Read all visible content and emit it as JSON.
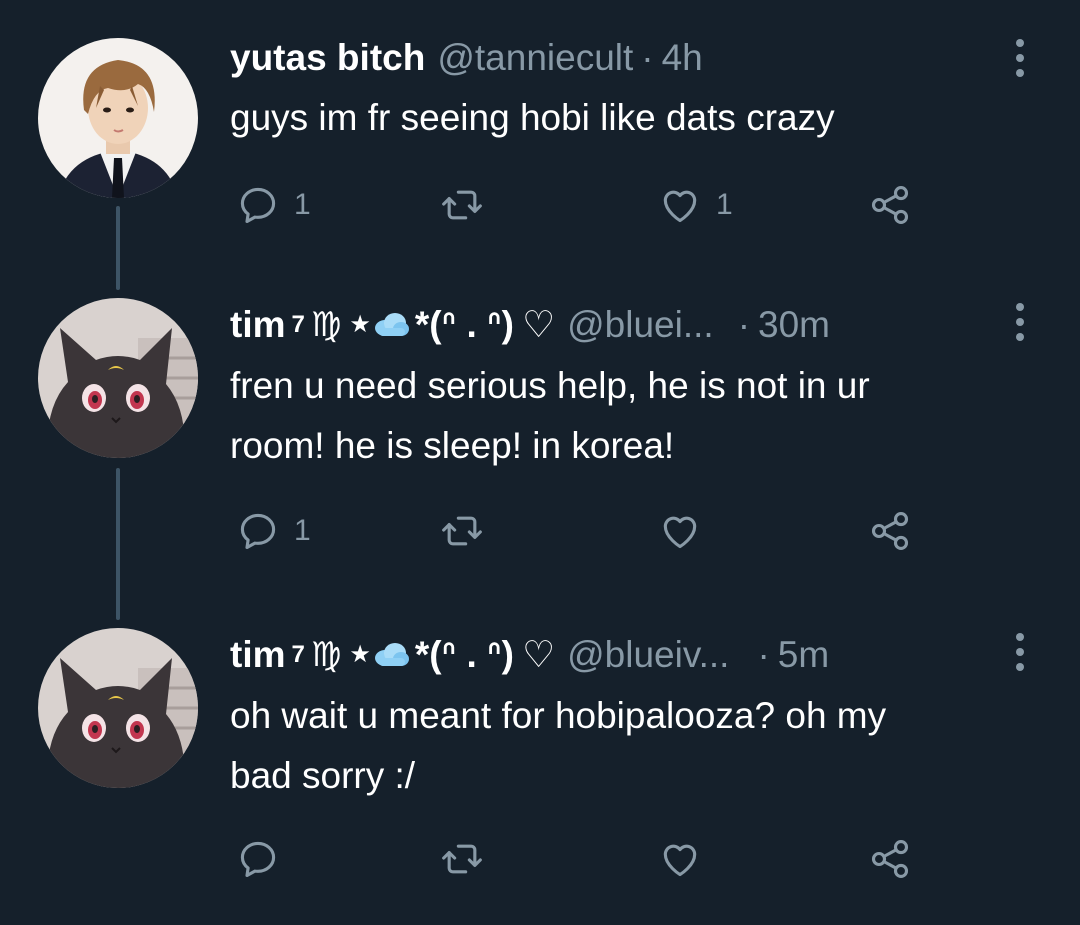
{
  "tweets": [
    {
      "name": "yutas bitch",
      "handle": "@tanniecult",
      "separator": "·",
      "time": "4h",
      "text": "guys im fr seeing hobi like dats crazy",
      "replies": "1",
      "retweets": "",
      "likes": "1",
      "avatar_icon": "person-portrait-avatar"
    },
    {
      "name": "tim",
      "name_sup": "7",
      "name_virgo": "♍",
      "name_star": "★",
      "name_kaomoji": "*(ᐢ . ᐢ)",
      "name_heart": "♡",
      "handle": "@bluei...",
      "separator": "·",
      "time": "30m",
      "text": "fren u need serious help, he is not in ur\nroom! he is sleep! in korea!",
      "replies": "1",
      "retweets": "",
      "likes": "",
      "avatar_icon": "black-cat-avatar"
    },
    {
      "name": "tim",
      "name_sup": "7",
      "name_virgo": "♍",
      "name_star": "★",
      "name_kaomoji": "*(ᐢ . ᐢ)",
      "name_heart": "♡",
      "handle": "@blueiv...",
      "separator": "·",
      "time": "5m",
      "text": "oh wait u meant for hobipalooza? oh my\nbad sorry :/",
      "replies": "",
      "retweets": "",
      "likes": "",
      "avatar_icon": "black-cat-avatar"
    }
  ],
  "colors": {
    "background": "#15202b",
    "text_primary": "#ffffff",
    "text_secondary": "#8899a6",
    "thread_line": "#3d5466"
  }
}
